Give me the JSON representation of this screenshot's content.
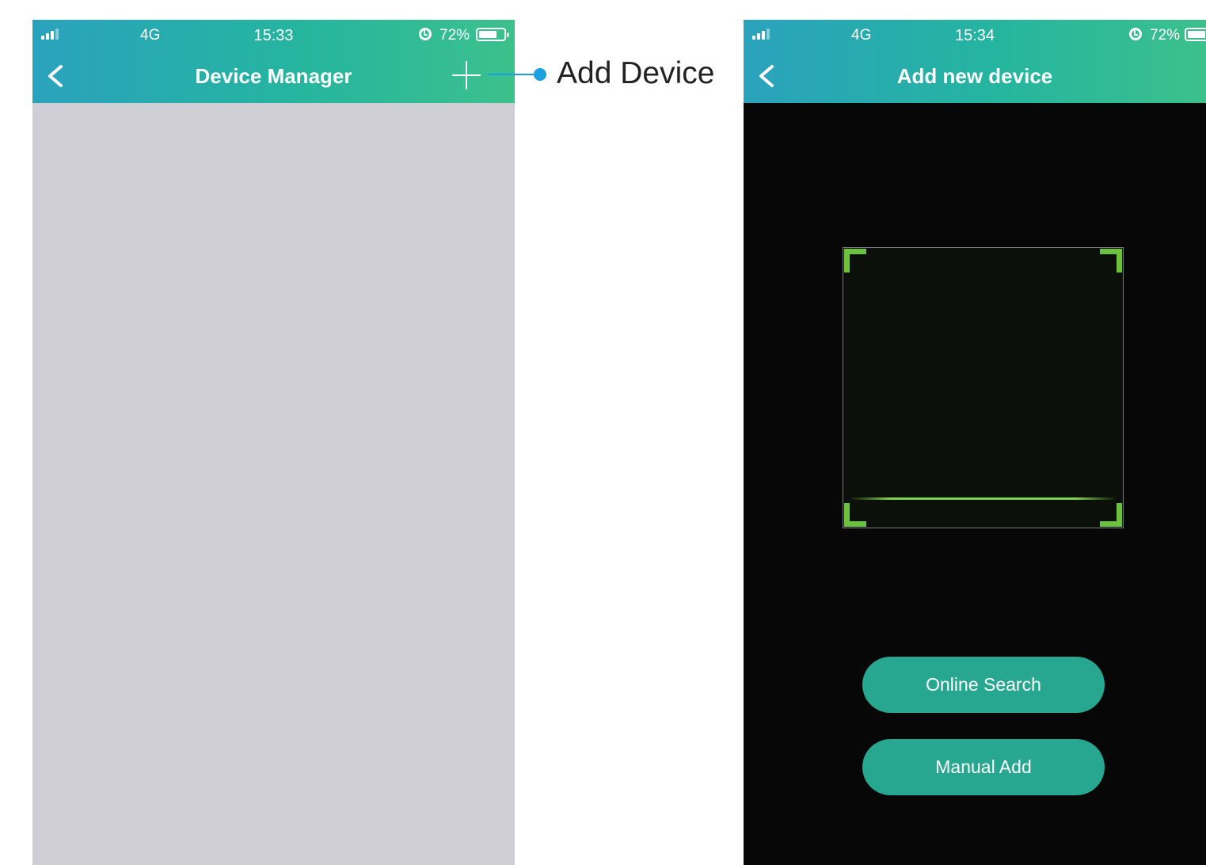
{
  "left_screen": {
    "status": {
      "network": "4G",
      "time": "15:33",
      "battery_pct": "72%",
      "battery_level": 0.72
    },
    "title": "Device Manager",
    "icons": {
      "back": "chevron-left-icon",
      "add": "plus-icon"
    }
  },
  "annotation": {
    "label": "Add Device",
    "color": "#1aa0e0"
  },
  "right_screen": {
    "status": {
      "network": "4G",
      "time": "15:34",
      "battery_pct": "72%",
      "battery_level": 0.72
    },
    "title": "Add new device",
    "buttons": {
      "online_search": "Online Search",
      "manual_add": "Manual Add"
    },
    "icons": {
      "back": "chevron-left-icon"
    }
  },
  "colors": {
    "header_gradient": [
      "#2aa2bd",
      "#25b59f",
      "#3cc08c"
    ],
    "button": "#27a690",
    "scan_frame": "#6cc140",
    "left_background": "#cfced5",
    "right_background": "#070707"
  }
}
